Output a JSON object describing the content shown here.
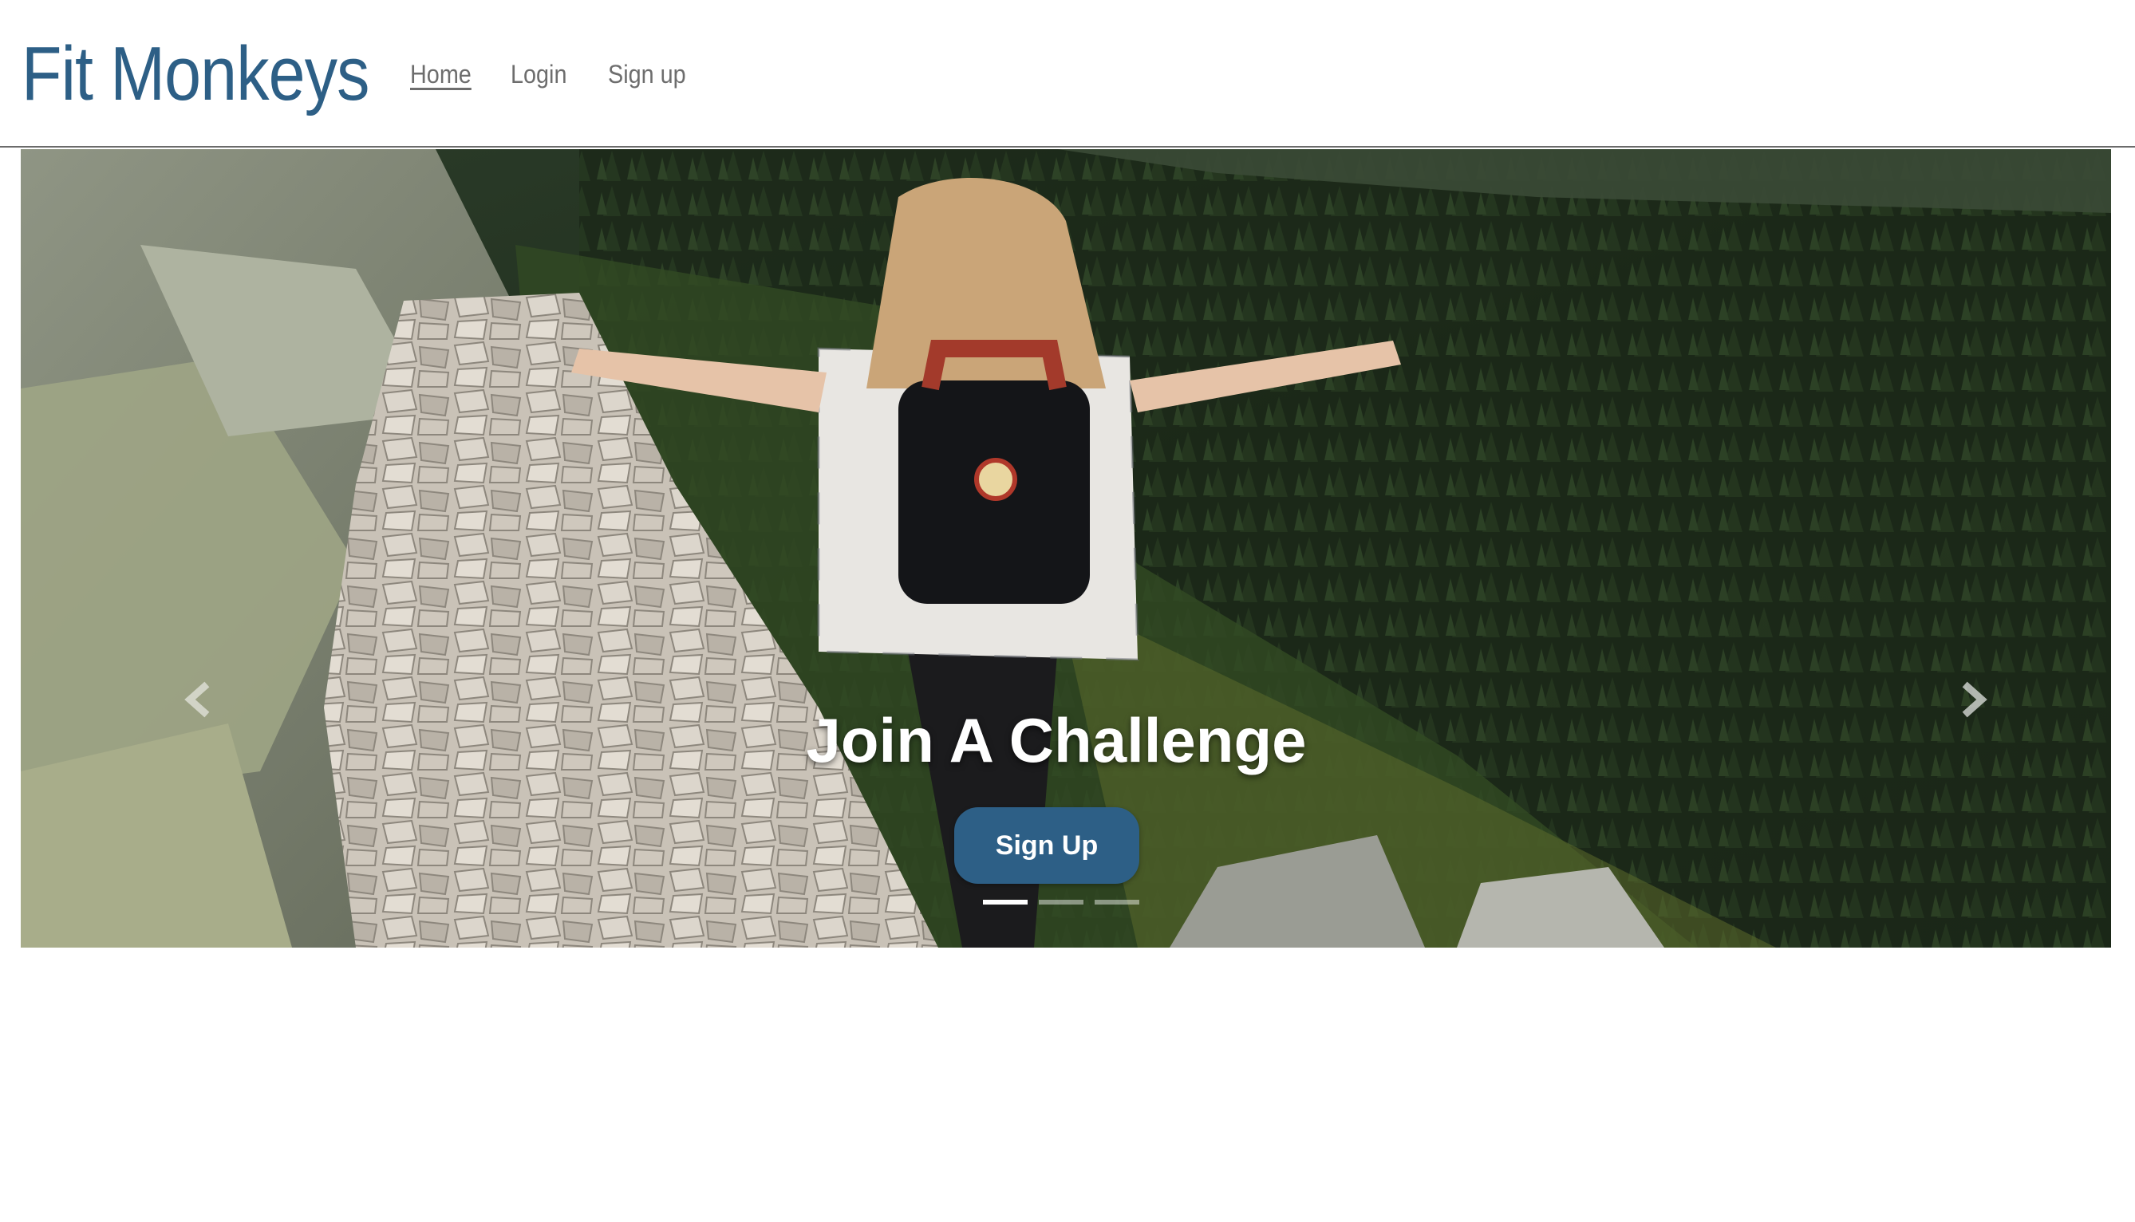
{
  "brand": {
    "name": "Fit Monkeys",
    "color": "#2d5f86"
  },
  "nav": {
    "links": [
      {
        "label": "Home",
        "active": true
      },
      {
        "label": "Login",
        "active": false
      },
      {
        "label": "Sign up",
        "active": false
      }
    ]
  },
  "carousel": {
    "slide_image": "woman-hiking-mountain-trail",
    "prev_icon": "chevron-left-icon",
    "next_icon": "chevron-right-icon",
    "caption_title": "Join A Challenge",
    "caption_button": "Sign Up",
    "indicators": {
      "count": 3,
      "active_index": 0
    }
  }
}
